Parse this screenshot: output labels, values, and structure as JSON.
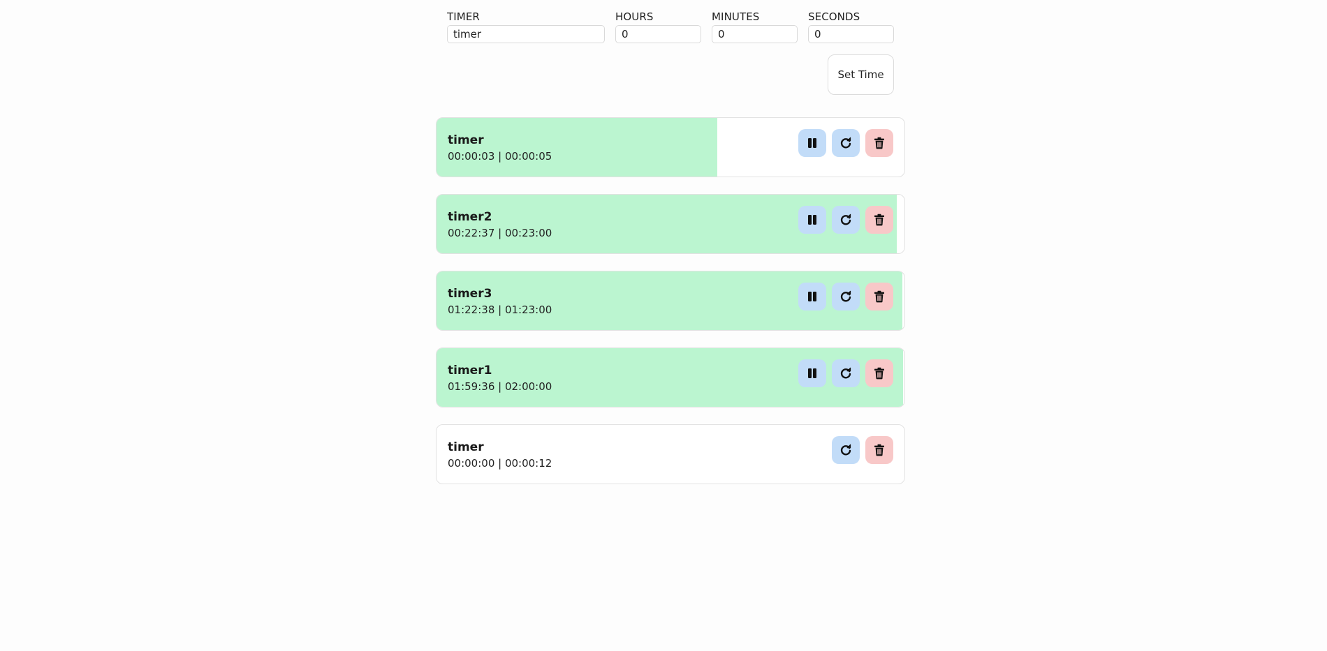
{
  "form": {
    "timer_label": "TIMER",
    "timer_value": "timer",
    "hours_label": "HOURS",
    "hours_value": "0",
    "minutes_label": "MINUTES",
    "minutes_value": "0",
    "seconds_label": "SECONDS",
    "seconds_value": "0",
    "set_time_label": "Set Time"
  },
  "timers": [
    {
      "name": "timer",
      "time": "00:00:03 | 00:00:05",
      "progress": 0.6,
      "running": true
    },
    {
      "name": "timer2",
      "time": "00:22:37 | 00:23:00",
      "progress": 0.983,
      "running": true
    },
    {
      "name": "timer3",
      "time": "01:22:38 | 01:23:00",
      "progress": 0.996,
      "running": true
    },
    {
      "name": "timer1",
      "time": "01:59:36 | 02:00:00",
      "progress": 0.997,
      "running": true
    },
    {
      "name": "timer",
      "time": "00:00:00 | 00:00:12",
      "progress": 0,
      "running": false
    }
  ],
  "icons": {
    "pause": "pause-icon",
    "reset": "reset-icon",
    "delete": "trash-icon"
  },
  "colors": {
    "progress": "#bbf5d0",
    "blue_button": "#c2dcf8",
    "red_button": "#f8c8c8"
  }
}
